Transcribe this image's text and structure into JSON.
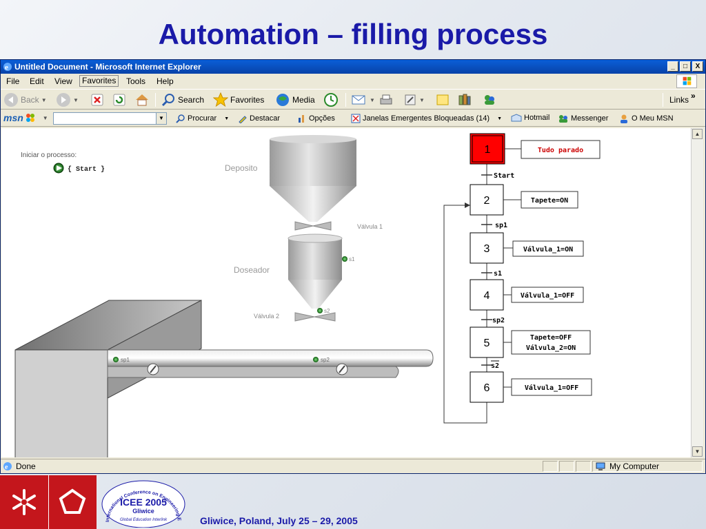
{
  "slide": {
    "title": "Automation – filling process",
    "footer_text": "Gliwice, Poland, July 25 – 29, 2005",
    "conference_logo": {
      "ring_text": "International Conference on Engineering Education",
      "name": "ICEE 2005",
      "city": "Gliwice",
      "tagline": "Global Education Interlink"
    }
  },
  "window": {
    "title": "Untitled Document - Microsoft Internet Explorer",
    "buttons": [
      "_",
      "□",
      "X"
    ]
  },
  "menu": [
    "File",
    "Edit",
    "View",
    "Favorites",
    "Tools",
    "Help"
  ],
  "toolbar": {
    "back": "Back",
    "search": "Search",
    "favorites": "Favorites",
    "media": "Media",
    "links": "Links",
    "more": "»"
  },
  "msnbar": {
    "brand": "msn",
    "procurar": "Procurar",
    "destacar": "Destacar",
    "opcoes": "Opções",
    "popups": "Janelas Emergentes Bloqueadas (14)",
    "hotmail": "Hotmail",
    "messenger": "Messenger",
    "my_msn": "O Meu MSN"
  },
  "simulation": {
    "start_prompt": "Iniciar o processo:",
    "start_button": "{ Start }",
    "deposito": "Deposito",
    "valvula1": "Válvula 1",
    "doseador": "Doseador",
    "valvula2": "Válvula 2",
    "sensor_s1": "s1",
    "sensor_s2": "s2",
    "sensor_sp1": "sp1",
    "sensor_sp2": "sp2"
  },
  "grafcet": {
    "steps": [
      {
        "number": "1",
        "action": "Tudo parado",
        "active": true
      },
      {
        "number": "2",
        "action": "Tapete=ON",
        "active": false
      },
      {
        "number": "3",
        "action": "Válvula_1=ON",
        "active": false
      },
      {
        "number": "4",
        "action": "Válvula_1=OFF",
        "active": false
      },
      {
        "number": "5",
        "action": "Tapete=OFF",
        "action2": "Válvula_2=ON",
        "active": false
      },
      {
        "number": "6",
        "action": "Válvula_1=OFF",
        "active": false
      }
    ],
    "transitions": [
      "Start",
      "sp1",
      "s1",
      "sp2",
      "s2"
    ],
    "colors": {
      "active": "#ff0000",
      "active_text": "#cc0000"
    }
  },
  "status": {
    "text": "Done",
    "zone": "My Computer"
  }
}
